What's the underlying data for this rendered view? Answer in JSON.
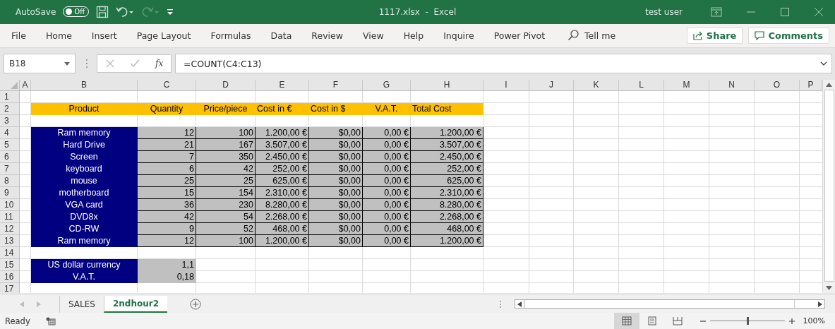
{
  "window": {
    "autosave_label": "AutoSave",
    "autosave": {
      "label": "Off",
      "on": false
    },
    "redo_disabled": true,
    "title": "1117.xlsx  -  Excel",
    "user": "test user"
  },
  "ribbon_tabs": [
    "File",
    "Home",
    "Insert",
    "Page Layout",
    "Formulas",
    "Data",
    "Review",
    "View",
    "Help",
    "Inquire",
    "Power Pivot"
  ],
  "tell_me": "Tell me",
  "share_button": "Share",
  "comments_button": "Comments",
  "formula_bar": {
    "name_box": "B18",
    "fx": "fx",
    "formula": "=COUNT(C4:C13)"
  },
  "sheet": {
    "columns": [
      "A",
      "B",
      "C",
      "D",
      "E",
      "F",
      "G",
      "H",
      "I",
      "J",
      "K",
      "L",
      "M",
      "N",
      "O",
      "P"
    ],
    "rows": [
      {
        "number": "1"
      },
      {
        "number": "2",
        "cells": [
          {
            "kind": "header",
            "centered": true,
            "text": "Product"
          },
          {
            "kind": "header",
            "centered": true,
            "text": "Quantity"
          },
          {
            "kind": "header",
            "centered": true,
            "text": "Price/piece"
          },
          {
            "kind": "header",
            "centered": false,
            "text": "Cost in €"
          },
          {
            "kind": "header",
            "centered": false,
            "text": "Cost in $"
          },
          {
            "kind": "header",
            "centered": true,
            "text": "V.A.T."
          },
          {
            "kind": "header",
            "centered": false,
            "text": "Total Cost"
          }
        ]
      },
      {
        "number": "3"
      },
      {
        "number": "4",
        "cells": [
          {
            "kind": "label",
            "text": "Ram memory"
          },
          {
            "kind": "value",
            "text": "12"
          },
          {
            "kind": "value",
            "text": "100"
          },
          {
            "kind": "value",
            "text": "1.200,00 €"
          },
          {
            "kind": "value",
            "text": "$0,00"
          },
          {
            "kind": "value",
            "text": "0,00 €"
          },
          {
            "kind": "value",
            "text": "1.200,00 €"
          }
        ]
      },
      {
        "number": "5",
        "cells": [
          {
            "kind": "label",
            "text": "Hard Drive"
          },
          {
            "kind": "value",
            "text": "21"
          },
          {
            "kind": "value",
            "text": "167"
          },
          {
            "kind": "value",
            "text": "3.507,00 €"
          },
          {
            "kind": "value",
            "text": "$0,00"
          },
          {
            "kind": "value",
            "text": "0,00 €"
          },
          {
            "kind": "value",
            "text": "3.507,00 €"
          }
        ]
      },
      {
        "number": "6",
        "cells": [
          {
            "kind": "label",
            "text": "Screen"
          },
          {
            "kind": "value",
            "text": "7"
          },
          {
            "kind": "value",
            "text": "350"
          },
          {
            "kind": "value",
            "text": "2.450,00 €"
          },
          {
            "kind": "value",
            "text": "$0,00"
          },
          {
            "kind": "value",
            "text": "0,00 €"
          },
          {
            "kind": "value",
            "text": "2.450,00 €"
          }
        ]
      },
      {
        "number": "7",
        "cells": [
          {
            "kind": "label",
            "text": "keyboard"
          },
          {
            "kind": "value",
            "text": "6"
          },
          {
            "kind": "value",
            "text": "42"
          },
          {
            "kind": "value",
            "text": "252,00 €"
          },
          {
            "kind": "value",
            "text": "$0,00"
          },
          {
            "kind": "value",
            "text": "0,00 €"
          },
          {
            "kind": "value",
            "text": "252,00 €"
          }
        ]
      },
      {
        "number": "8",
        "cells": [
          {
            "kind": "label",
            "text": "mouse"
          },
          {
            "kind": "value",
            "text": "25"
          },
          {
            "kind": "value",
            "text": "25"
          },
          {
            "kind": "value",
            "text": "625,00 €"
          },
          {
            "kind": "value",
            "text": "$0,00"
          },
          {
            "kind": "value",
            "text": "0,00 €"
          },
          {
            "kind": "value",
            "text": "625,00 €"
          }
        ]
      },
      {
        "number": "9",
        "cells": [
          {
            "kind": "label",
            "text": "motherboard"
          },
          {
            "kind": "value",
            "text": "15"
          },
          {
            "kind": "value",
            "text": "154"
          },
          {
            "kind": "value",
            "text": "2.310,00 €"
          },
          {
            "kind": "value",
            "text": "$0,00"
          },
          {
            "kind": "value",
            "text": "0,00 €"
          },
          {
            "kind": "value",
            "text": "2.310,00 €"
          }
        ]
      },
      {
        "number": "10",
        "cells": [
          {
            "kind": "label",
            "text": "VGA card"
          },
          {
            "kind": "value",
            "text": "36"
          },
          {
            "kind": "value",
            "text": "230"
          },
          {
            "kind": "value",
            "text": "8.280,00 €"
          },
          {
            "kind": "value",
            "text": "$0,00"
          },
          {
            "kind": "value",
            "text": "0,00 €"
          },
          {
            "kind": "value",
            "text": "8.280,00 €"
          }
        ]
      },
      {
        "number": "11",
        "cells": [
          {
            "kind": "label",
            "text": "DVD8x"
          },
          {
            "kind": "value",
            "text": "42"
          },
          {
            "kind": "value",
            "text": "54"
          },
          {
            "kind": "value",
            "text": "2.268,00 €"
          },
          {
            "kind": "value",
            "text": "$0,00"
          },
          {
            "kind": "value",
            "text": "0,00 €"
          },
          {
            "kind": "value",
            "text": "2.268,00 €"
          }
        ]
      },
      {
        "number": "12",
        "cells": [
          {
            "kind": "label",
            "text": "CD-RW"
          },
          {
            "kind": "value",
            "text": "9"
          },
          {
            "kind": "value",
            "text": "52"
          },
          {
            "kind": "value",
            "text": "468,00 €"
          },
          {
            "kind": "value",
            "text": "$0,00"
          },
          {
            "kind": "value",
            "text": "0,00 €"
          },
          {
            "kind": "value",
            "text": "468,00 €"
          }
        ]
      },
      {
        "number": "13",
        "cells": [
          {
            "kind": "label",
            "text": "Ram memory"
          },
          {
            "kind": "value",
            "text": "12"
          },
          {
            "kind": "value",
            "text": "100"
          },
          {
            "kind": "value",
            "text": "1.200,00 €"
          },
          {
            "kind": "value",
            "text": "$0,00"
          },
          {
            "kind": "value",
            "text": "0,00 €"
          },
          {
            "kind": "value",
            "text": "1.200,00 €"
          }
        ]
      },
      {
        "number": "14"
      },
      {
        "number": "15",
        "cells": [
          {
            "kind": "label",
            "text": "US dollar currency"
          },
          {
            "kind": "param",
            "text": "1,1"
          }
        ]
      },
      {
        "number": "16",
        "cells": [
          {
            "kind": "label",
            "text": "V.A.T."
          },
          {
            "kind": "param",
            "text": "0,18"
          }
        ]
      },
      {
        "number": "17"
      }
    ]
  },
  "sheet_tabs": [
    {
      "label": "SALES",
      "selected": false
    },
    {
      "label": "2ndhour2",
      "selected": true
    }
  ],
  "status_bar": {
    "status": "Ready",
    "views": [
      {
        "kind": "normal",
        "selected": true
      },
      {
        "kind": "layout",
        "selected": false
      },
      {
        "kind": "break",
        "selected": false
      }
    ],
    "zoom": {
      "level": 0.5,
      "reading": "100%"
    }
  }
}
